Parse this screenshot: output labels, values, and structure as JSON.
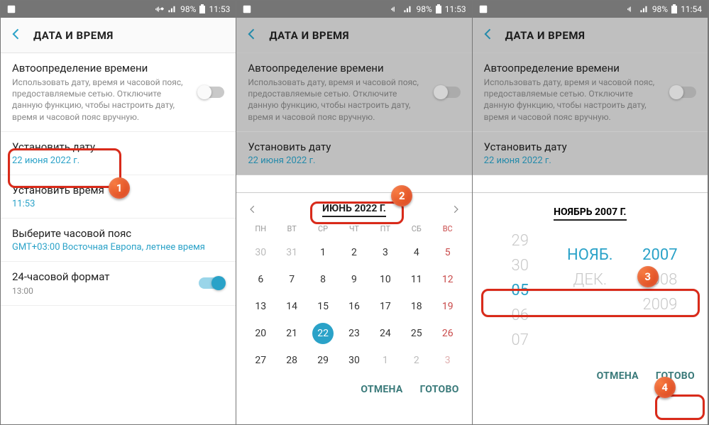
{
  "status": {
    "battery": "98%",
    "t1": "11:53",
    "t2": "11:53",
    "t3": "11:54"
  },
  "header": {
    "title": "ДАТА И ВРЕМЯ"
  },
  "rows": {
    "auto": {
      "label": "Автоопределение времени",
      "desc": "Использовать дату, время и часовой пояс, предоставляемые сетью. Отключите данную функцию, чтобы настроить дату, время и часовой пояс вручную."
    },
    "setdate": {
      "label": "Установить дату",
      "val": "22 июня 2022 г."
    },
    "settime": {
      "label": "Установить время",
      "val": "11:53"
    },
    "tz": {
      "label": "Выберите часовой пояс",
      "val": "GMT+03:00 Восточная Европа, летнее время"
    },
    "h24": {
      "label": "24-часовой формат",
      "val": "13:00"
    }
  },
  "calendar": {
    "month": "ИЮНЬ 2022 Г.",
    "dow": [
      "ПН",
      "ВТ",
      "СР",
      "ЧТ",
      "ПТ",
      "СБ",
      "ВС"
    ],
    "days": [
      {
        "n": "30",
        "dim": true
      },
      {
        "n": "31",
        "dim": true
      },
      {
        "n": "1"
      },
      {
        "n": "2"
      },
      {
        "n": "3"
      },
      {
        "n": "4"
      },
      {
        "n": "5",
        "sun": true
      },
      {
        "n": "6"
      },
      {
        "n": "7"
      },
      {
        "n": "8"
      },
      {
        "n": "9"
      },
      {
        "n": "10"
      },
      {
        "n": "11"
      },
      {
        "n": "12",
        "sun": true
      },
      {
        "n": "13"
      },
      {
        "n": "14"
      },
      {
        "n": "15"
      },
      {
        "n": "16"
      },
      {
        "n": "17"
      },
      {
        "n": "18"
      },
      {
        "n": "19",
        "sun": true
      },
      {
        "n": "20"
      },
      {
        "n": "21"
      },
      {
        "n": "22",
        "sel": true
      },
      {
        "n": "23"
      },
      {
        "n": "24"
      },
      {
        "n": "25"
      },
      {
        "n": "26",
        "sun": true
      },
      {
        "n": "27"
      },
      {
        "n": "28"
      },
      {
        "n": "29"
      },
      {
        "n": "30"
      },
      {
        "n": "1",
        "dim": true
      },
      {
        "n": "2",
        "dim": true
      },
      {
        "n": "3",
        "dim": true,
        "sun": true
      }
    ],
    "cancel": "ОТМЕНА",
    "ok": "ГОТОВО"
  },
  "spinner": {
    "title": "НОЯБРЬ 2007 Г.",
    "day": [
      "29",
      "30",
      "05",
      "06",
      "07"
    ],
    "month": [
      "",
      "",
      "НОЯБ.",
      "ДЕК.",
      ""
    ],
    "year": [
      "",
      "",
      "2007",
      "2008",
      "2009"
    ],
    "cancel": "ОТМЕНА",
    "ok": "ГОТОВО"
  },
  "badges": {
    "b1": "1",
    "b2": "2",
    "b3": "3",
    "b4": "4"
  }
}
